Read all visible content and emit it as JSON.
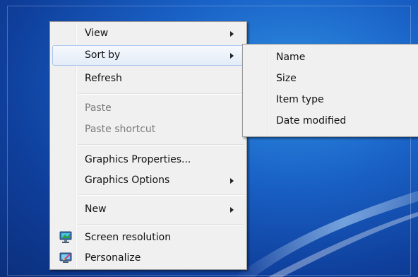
{
  "desktop": {
    "background_color": "#1a63c8"
  },
  "context_menu": {
    "items": [
      {
        "label": "View",
        "submenu": true
      },
      {
        "label": "Sort by",
        "submenu": true,
        "highlighted": true
      },
      {
        "label": "Refresh"
      },
      {
        "label": "Paste",
        "disabled": true
      },
      {
        "label": "Paste shortcut",
        "disabled": true
      },
      {
        "label": "Graphics Properties..."
      },
      {
        "label": "Graphics Options",
        "submenu": true
      },
      {
        "label": "New",
        "submenu": true
      },
      {
        "label": "Screen resolution",
        "icon": "monitor-icon"
      },
      {
        "label": "Personalize",
        "icon": "personalize-icon"
      }
    ]
  },
  "sort_submenu": {
    "items": [
      {
        "label": "Name"
      },
      {
        "label": "Size"
      },
      {
        "label": "Item type"
      },
      {
        "label": "Date modified"
      }
    ]
  }
}
